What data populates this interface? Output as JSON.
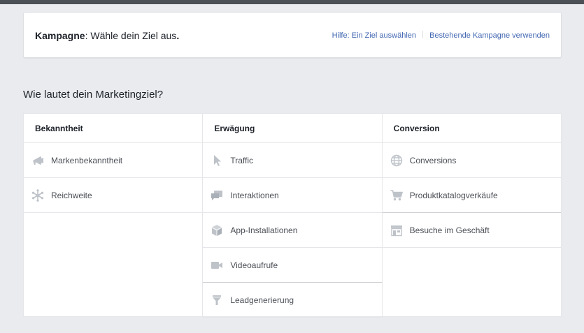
{
  "header": {
    "title_bold": "Kampagne",
    "title_rest": ": Wähle dein Ziel aus",
    "title_end": ".",
    "links": [
      "Hilfe: Ein Ziel auswählen",
      "Bestehende Kampagne verwenden"
    ]
  },
  "question": "Wie lautet dein Marketingziel?",
  "icon_color": "#bec3c9",
  "link_color": "#4267b2",
  "columns": [
    {
      "title": "Bekanntheit",
      "options": [
        {
          "label": "Markenbekanntheit",
          "icon": "megaphone-icon"
        },
        {
          "label": "Reichweite",
          "icon": "asterisk-reach-icon"
        }
      ]
    },
    {
      "title": "Erwägung",
      "options": [
        {
          "label": "Traffic",
          "icon": "cursor-icon"
        },
        {
          "label": "Interaktionen",
          "icon": "chat-bubbles-icon"
        },
        {
          "label": "App-Installationen",
          "icon": "box-icon"
        },
        {
          "label": "Videoaufrufe",
          "icon": "video-camera-icon"
        },
        {
          "label": "Leadgenerierung",
          "icon": "funnel-icon"
        }
      ]
    },
    {
      "title": "Conversion",
      "options": [
        {
          "label": "Conversions",
          "icon": "globe-icon"
        },
        {
          "label": "Produktkatalogverkäufe",
          "icon": "shopping-cart-icon"
        },
        {
          "label": "Besuche im Geschäft",
          "icon": "store-icon"
        }
      ]
    }
  ]
}
